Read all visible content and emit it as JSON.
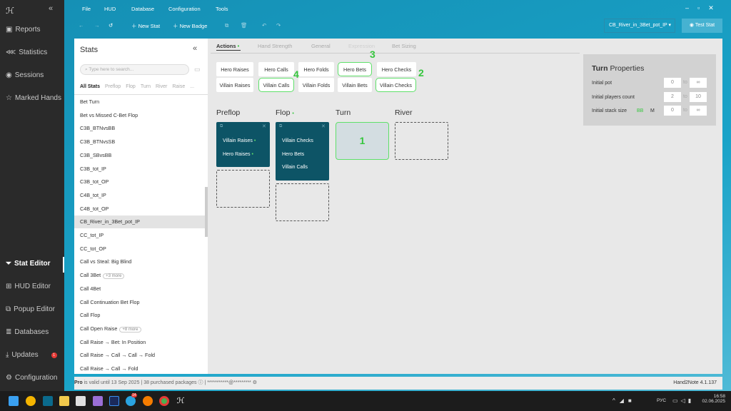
{
  "sidebar": {
    "items": [
      {
        "label": "Reports",
        "icon": "report-icon"
      },
      {
        "label": "Statistics",
        "icon": "statistics-icon"
      },
      {
        "label": "Sessions",
        "icon": "sessions-icon"
      },
      {
        "label": "Marked Hands",
        "icon": "star-icon"
      }
    ],
    "bottom": [
      {
        "label": "Stat Editor",
        "icon": "filter-icon"
      },
      {
        "label": "HUD Editor",
        "icon": "hud-icon"
      },
      {
        "label": "Popup Editor",
        "icon": "popup-icon"
      },
      {
        "label": "Databases",
        "icon": "database-icon"
      },
      {
        "label": "Updates",
        "icon": "download-icon"
      },
      {
        "label": "Configuration",
        "icon": "gear-icon"
      }
    ]
  },
  "menu": [
    "File",
    "HUD",
    "Database",
    "Configuration",
    "Tools"
  ],
  "toolbar": {
    "new_stat": "New Stat",
    "new_badge": "New Badge",
    "stat_select": "CB_River_in_3Bet_pot_IP",
    "test_stat": "Test Stat"
  },
  "stats": {
    "title": "Stats",
    "search_placeholder": "Type here to search...",
    "filters": [
      "All Stats",
      "Preflop",
      "Flop",
      "Turn",
      "River",
      "Raise",
      "..."
    ],
    "items": [
      "Bet Turn",
      "Bet vs Missed C-Bet Flop",
      "C3B_BTNvsBB",
      "C3B_BTNvsSB",
      "C3B_SBvsBB",
      "C3B_tot_IP",
      "C3B_tot_OP",
      "C4B_tot_IP",
      "C4B_tot_OP",
      "CB_River_in_3Bet_pot_IP",
      "CC_tot_IP",
      "CC_tot_OP",
      "Call vs Steal: Big Blind",
      "Call 3Bet",
      "Call 4Bet",
      "Call Continuation Bet Flop",
      "Call Flop",
      "Call Open Raise",
      "Call Raise → Bet: In Position",
      "Call Raise → Call → Call → Fold",
      "Call Raise → Call → Fold"
    ],
    "more": {
      "call3bet": "+3 more",
      "callopen": "+8 more"
    }
  },
  "tabs": [
    "Actions",
    "Hand Strength",
    "General",
    "Expression",
    "Bet Sizing"
  ],
  "actions": {
    "row1": [
      "Hero Raises",
      "Hero Calls",
      "Hero Folds",
      "Hero Bets",
      "Hero Checks"
    ],
    "row2": [
      "Villain Raises",
      "Villain Calls",
      "Villain Folds",
      "Villain Bets",
      "Villain Checks"
    ]
  },
  "annotations": [
    "1",
    "2",
    "3",
    "4"
  ],
  "streets": {
    "preflop": "Preflop",
    "flop": "Flop",
    "turn": "Turn",
    "river": "River"
  },
  "preflop_node": [
    "Villain Raises",
    "Hero Raises"
  ],
  "flop_node": [
    "Villain Checks",
    "Hero Bets",
    "Villain Calls"
  ],
  "properties": {
    "title_bold": "Turn",
    "title_rest": "Properties",
    "initial_pot": "Initial pot",
    "players": "Initial players count",
    "stack": "Initial stack size",
    "bb": "BB",
    "m": "M",
    "to": "to",
    "pot_from": "0",
    "pot_to": "∞",
    "players_from": "2",
    "players_to": "10",
    "stack_from": "0",
    "stack_to": "∞"
  },
  "footer": {
    "pro": "Pro",
    "valid": "is valid until 13 Sep 2025",
    "packages": "38 purchased packages",
    "email": "***********@*********",
    "version": "Hand2Note 4.1.137"
  },
  "taskbar": {
    "lang": "РУС",
    "time": "16:58",
    "date": "02.06.2025",
    "badge": "14"
  },
  "updates_badge": "1"
}
